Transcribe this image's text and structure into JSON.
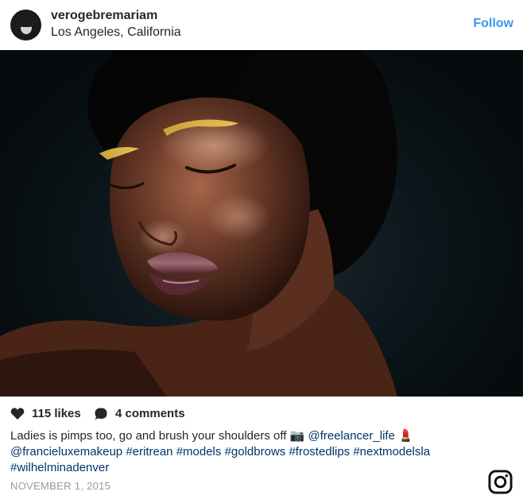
{
  "header": {
    "username": "verogebremariam",
    "location": "Los Angeles, California",
    "follow_label": "Follow"
  },
  "photo": {
    "alt_subject": "portrait with gold brows and frosted lips"
  },
  "actions": {
    "likes": "115 likes",
    "comments": "4 comments"
  },
  "caption": {
    "line1_text": "Ladies is pimps too, go and brush your shoulders off ",
    "camera_emoji": "📷",
    "mention1": "@freelancer_life",
    "lipstick_emoji": "💄",
    "mention2": "@francieluxemakeup",
    "tags": [
      "#eritrean",
      "#models",
      "#goldbrows",
      "#frostedlips",
      "#nextmodelsla",
      "#wilhelminadenver"
    ]
  },
  "date": "NOVEMBER 1, 2015",
  "colors": {
    "accent": "#3897f0",
    "link": "#003569",
    "muted": "#999999"
  },
  "icons": [
    "heart-icon",
    "comment-icon",
    "instagram-icon",
    "camera-emoji",
    "lipstick-emoji"
  ]
}
